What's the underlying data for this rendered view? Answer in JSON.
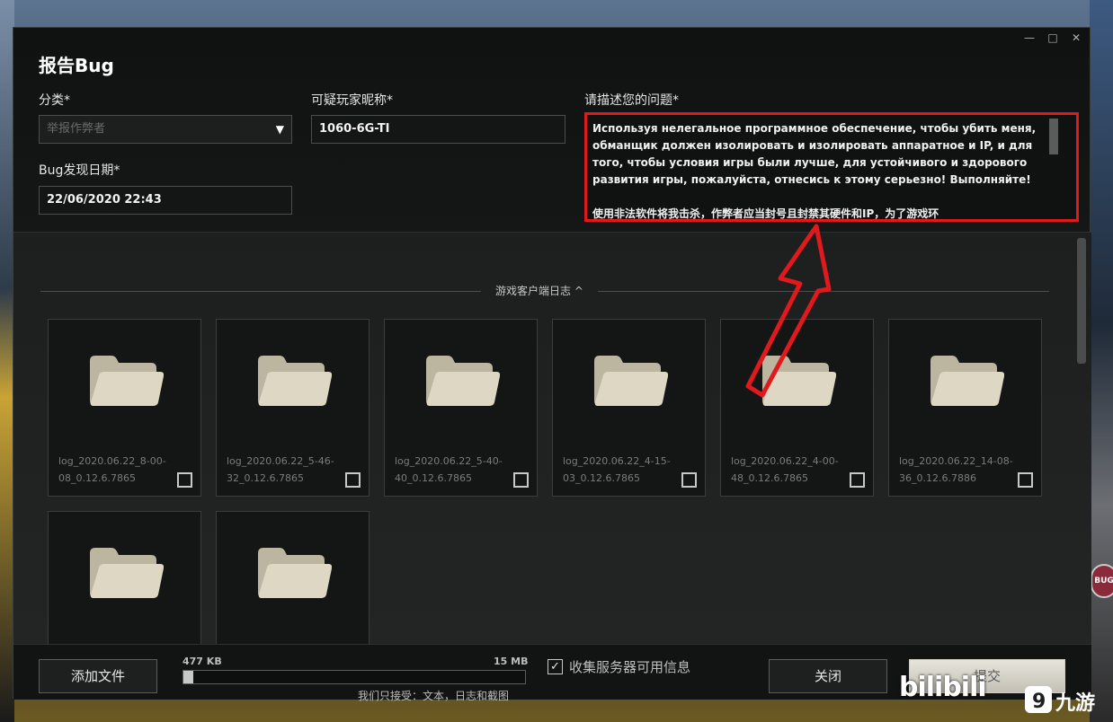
{
  "window": {
    "title": "报告Bug",
    "controls": [
      "—",
      "□",
      "✕"
    ]
  },
  "form": {
    "category_label": "分类*",
    "category_value": "举报作弊者",
    "nickname_label": "可疑玩家昵称*",
    "nickname_value": "1060-6G-TI",
    "date_label": "Bug发现日期*",
    "date_value": "22/06/2020 22:43",
    "description_label": "请描述您的问题*",
    "description_text": "Используя нелегальное программное обеспечение, чтобы убить меня, обманщик должен изолировать и изолировать аппаратное и IP, и для того, чтобы условия игры были лучше, для устойчивого и здорового развития игры, пожалуйста, отнесись к этому серьезно! Выполняйте!\n\n使用非法软件将我击杀，作弊者应当封号且封禁其硬件和IP，为了游戏环"
  },
  "logs": {
    "section_title": "游戏客户端日志 ^",
    "files": [
      {
        "name": "log_2020.06.22_8-00-08_0.12.6.7865"
      },
      {
        "name": "log_2020.06.22_5-46-32_0.12.6.7865"
      },
      {
        "name": "log_2020.06.22_5-40-40_0.12.6.7865"
      },
      {
        "name": "log_2020.06.22_4-15-03_0.12.6.7865"
      },
      {
        "name": "log_2020.06.22_4-00-48_0.12.6.7865"
      },
      {
        "name": "log_2020.06.22_14-08-36_0.12.6.7886"
      },
      {
        "name": ""
      },
      {
        "name": ""
      }
    ]
  },
  "footer": {
    "add_file": "添加文件",
    "size_current": "477 KB",
    "size_max": "15 MB",
    "progress_fraction": 0.03,
    "accept_note": "我们只接受：文本，日志和截图",
    "collect_info_label": "收集服务器可用信息",
    "collect_info_checked": true,
    "close": "关闭",
    "submit": "提交"
  },
  "watermark": {
    "left": "bilibili",
    "right": "九游"
  },
  "colors": {
    "highlight": "#e0191d",
    "folder": "#d9d3bf"
  }
}
